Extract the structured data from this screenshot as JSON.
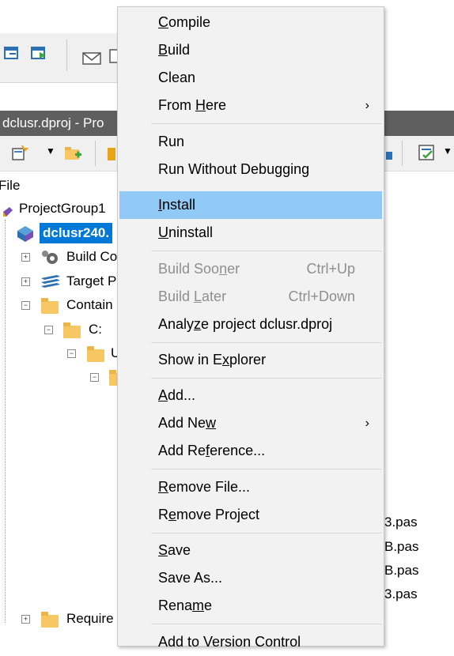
{
  "background": {
    "title_bar": "dclusr.dproj - Pro",
    "tree_header": "File",
    "tree": {
      "group": "ProjectGroup1",
      "project": "dclusr240.",
      "build_config": "Build Co",
      "target": "Target P",
      "contains": "Contain",
      "drive": "C:",
      "sub": "U",
      "requires": "Require"
    },
    "files": [
      "3.pas",
      "B.pas",
      "B.pas",
      "3.pas"
    ]
  },
  "menu": {
    "items": [
      {
        "id": "compile",
        "pre": "",
        "u": "C",
        "post": "ompile"
      },
      {
        "id": "build",
        "pre": "",
        "u": "B",
        "post": "uild"
      },
      {
        "id": "clean",
        "pre": "Clean",
        "u": "",
        "post": ""
      },
      {
        "id": "from-here",
        "pre": "From ",
        "u": "H",
        "post": "ere",
        "submenu": "›"
      },
      {
        "id": "run",
        "pre": "Run",
        "u": "",
        "post": ""
      },
      {
        "id": "run-without-debugging",
        "pre": "Run Without Debugging",
        "u": "",
        "post": ""
      },
      {
        "id": "install",
        "pre": "",
        "u": "I",
        "post": "nstall"
      },
      {
        "id": "uninstall",
        "pre": "",
        "u": "U",
        "post": "ninstall"
      },
      {
        "id": "build-sooner",
        "pre": "Build Soo",
        "u": "n",
        "post": "er",
        "shortcut": "Ctrl+Up"
      },
      {
        "id": "build-later",
        "pre": "Build ",
        "u": "L",
        "post": "ater",
        "shortcut": "Ctrl+Down"
      },
      {
        "id": "analyze",
        "pre": "Analy",
        "u": "z",
        "post": "e project dclusr.dproj"
      },
      {
        "id": "show-in-explorer",
        "pre": "Show in E",
        "u": "x",
        "post": "plorer"
      },
      {
        "id": "add",
        "pre": "",
        "u": "A",
        "post": "dd..."
      },
      {
        "id": "add-new",
        "pre": "Add Ne",
        "u": "w",
        "post": "",
        "submenu": "›"
      },
      {
        "id": "add-reference",
        "pre": "Add Re",
        "u": "f",
        "post": "erence..."
      },
      {
        "id": "remove-file",
        "pre": "",
        "u": "R",
        "post": "emove File..."
      },
      {
        "id": "remove-project",
        "pre": "R",
        "u": "e",
        "post": "move Project"
      },
      {
        "id": "save",
        "pre": "",
        "u": "S",
        "post": "ave"
      },
      {
        "id": "save-as",
        "pre": "Save As...",
        "u": "",
        "post": ""
      },
      {
        "id": "rename",
        "pre": "Rena",
        "u": "m",
        "post": "e"
      },
      {
        "id": "add-to-version-control",
        "pre": "Add to Version Control",
        "u": "",
        "post": ""
      }
    ]
  },
  "colors": {
    "highlight": "#91c9f7",
    "menu_bg": "#f2f2f2",
    "disabled_text": "#8f8f8f",
    "title_bar": "#5f5f5f",
    "selected_tree": "#0078d7"
  }
}
